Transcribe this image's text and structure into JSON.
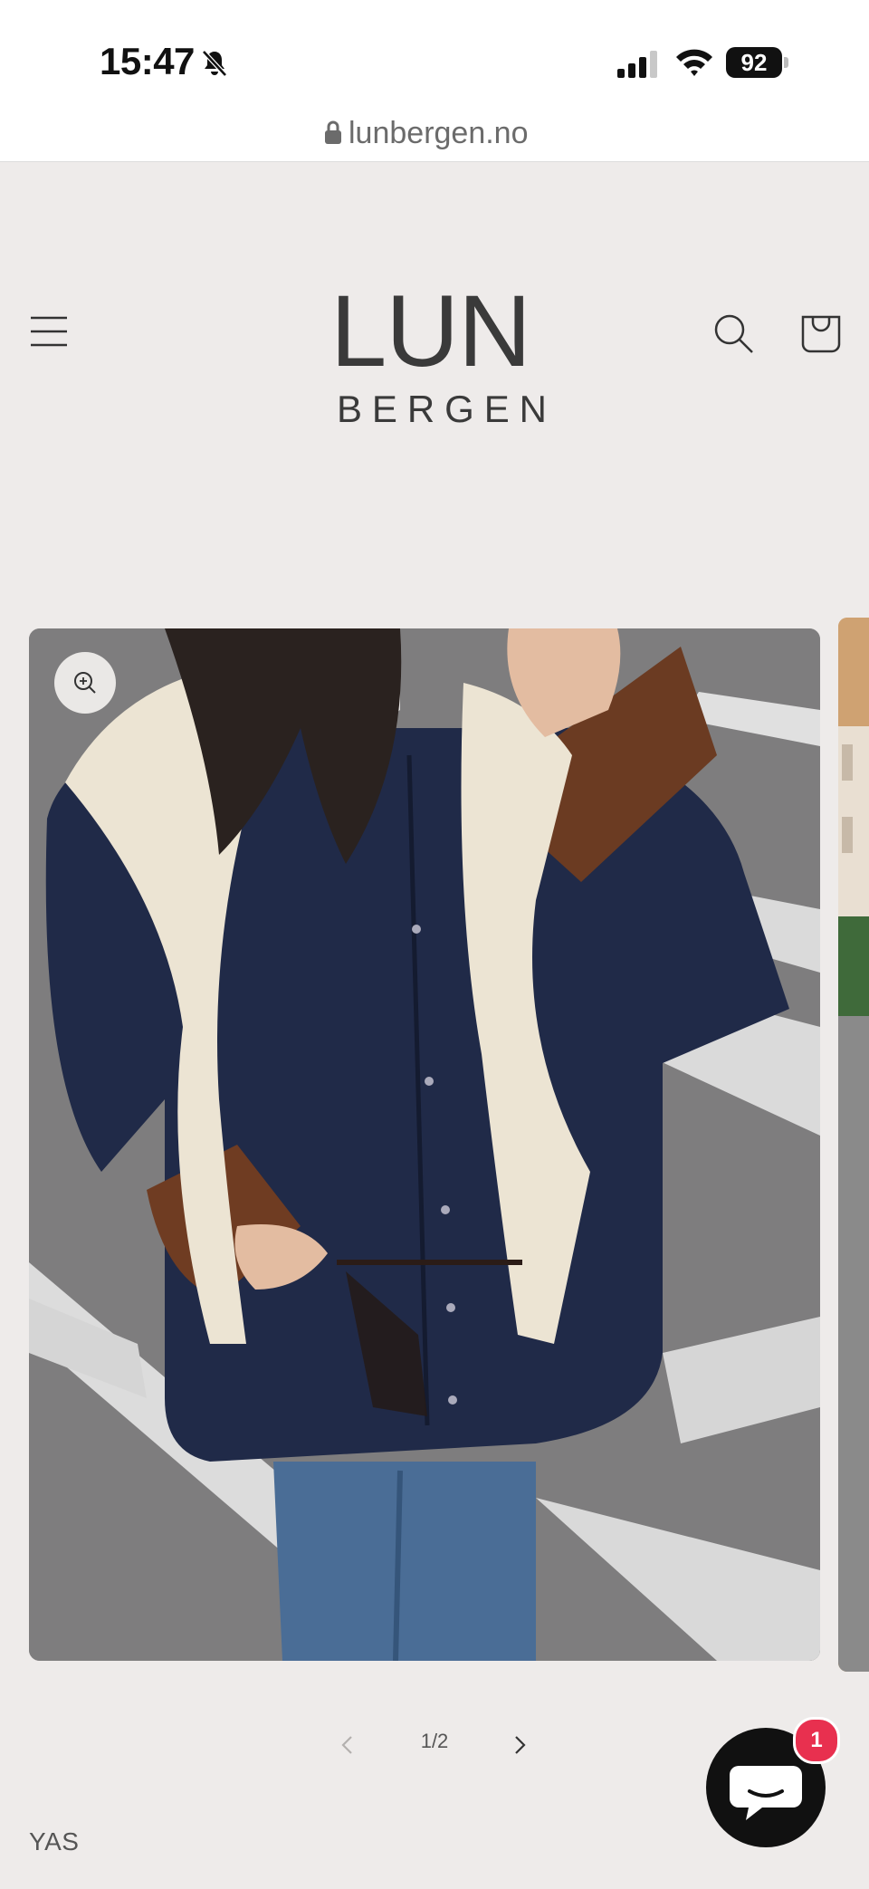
{
  "status_bar": {
    "time": "15:47",
    "battery": "92"
  },
  "browser": {
    "url": "lunbergen.no"
  },
  "header": {
    "logo_top": "LUN",
    "logo_bottom": "BERGEN"
  },
  "gallery": {
    "counter": "1/2"
  },
  "product": {
    "brand": "YAS"
  },
  "chat": {
    "badge": "1"
  },
  "colors": {
    "background": "#eeebea",
    "badge": "#e8304f",
    "chat": "#111111"
  }
}
